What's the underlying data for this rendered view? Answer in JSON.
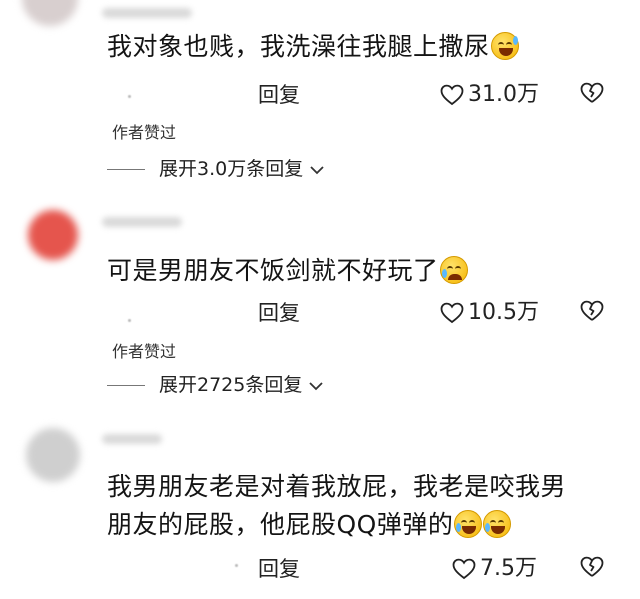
{
  "comments": [
    {
      "text": "我对象也贱，我洗澡往我腿上撒尿",
      "emoji": "grinning-sweat-emoji",
      "reply_label": "回复",
      "likes": "31.0万",
      "author_liked": "作者赞过",
      "expand_label": "展开3.0万条回复"
    },
    {
      "text": "可是男朋友不饭剑就不好玩了",
      "emoji": "crying-emoji",
      "reply_label": "回复",
      "likes": "10.5万",
      "author_liked": "作者赞过",
      "expand_label": "展开2725条回复"
    },
    {
      "text_line1": "我男朋友老是对着我放屁，我老是咬我男",
      "text_line2": "朋友的屁股，他屁股QQ弹弹的",
      "emoji": "laughing-tears-emoji",
      "reply_label": "回复",
      "likes": "7.5万"
    }
  ],
  "colors": {
    "text": "#141414",
    "avatar1": "#d8cfcf",
    "avatar2": "#e5554d",
    "avatar3": "#cfcfcf",
    "emoji": "#f5b400"
  }
}
